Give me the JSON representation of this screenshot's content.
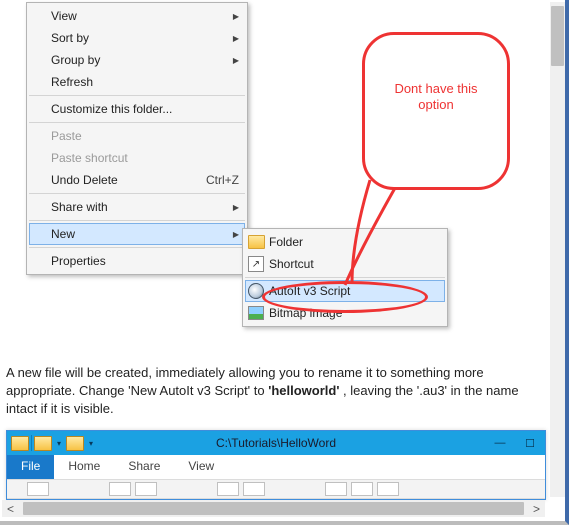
{
  "context_menu": {
    "view": "View",
    "sort_by": "Sort by",
    "group_by": "Group by",
    "refresh": "Refresh",
    "customize": "Customize this folder...",
    "paste": "Paste",
    "paste_shortcut": "Paste shortcut",
    "undo_delete": "Undo Delete",
    "undo_delete_key": "Ctrl+Z",
    "share_with": "Share with",
    "new": "New",
    "properties": "Properties"
  },
  "submenu": {
    "folder": "Folder",
    "shortcut": "Shortcut",
    "autoit": "AutoIt v3 Script",
    "bitmap": "Bitmap image"
  },
  "callout": {
    "line1": "Dont have this",
    "line2": "option"
  },
  "body": {
    "p1a": "A new file will be created, immediately allowing you to rename it to something more appropriate. Change 'New AutoIt v3 Script' to ",
    "p1b": "'helloworld'",
    "p1c": ", leaving the '.au3' in the name intact if it is visible."
  },
  "explorer": {
    "title_path": "C:\\Tutorials\\HelloWord",
    "tabs": {
      "file": "File",
      "home": "Home",
      "share": "Share",
      "view": "View"
    }
  }
}
